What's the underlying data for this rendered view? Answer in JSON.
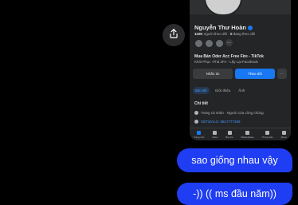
{
  "profile": {
    "name": "Nguyễn Thư Hoàn",
    "stats_count": "110K",
    "stats_label": "người theo dõi",
    "following_count": "0",
    "following_label": "đang theo dõi",
    "friends_more": "···",
    "bio_title": "Mua Bán Oder Acc Free Fire - TikTok",
    "bio_subtitle": "Khôi Phục -Phá 2FA - Lấy Lại Facebook",
    "message_button": "Nhắn tin",
    "follow_button": "Theo dõi",
    "more_button": "···",
    "tabs": [
      "Bài viết",
      "Giới thiệu",
      "Ảnh"
    ],
    "details_title": "Chi tiết",
    "detail_page": "Trang cá nhân · Người của công chúng",
    "detail_phone": "SDT/ZALO: 0817777459",
    "nav": [
      "Trang chủ",
      "Video",
      "Bạn bè",
      "Marketplace",
      "Thông báo",
      "Menu"
    ]
  },
  "chat": {
    "message1": "sao giống nhau vậy",
    "message2": "-)) (( ms đầu năm))"
  },
  "colors": {
    "bubble": "#1f3df2",
    "accent": "#1877f2",
    "background": "#000000"
  },
  "icons": {
    "share": "share-icon"
  }
}
